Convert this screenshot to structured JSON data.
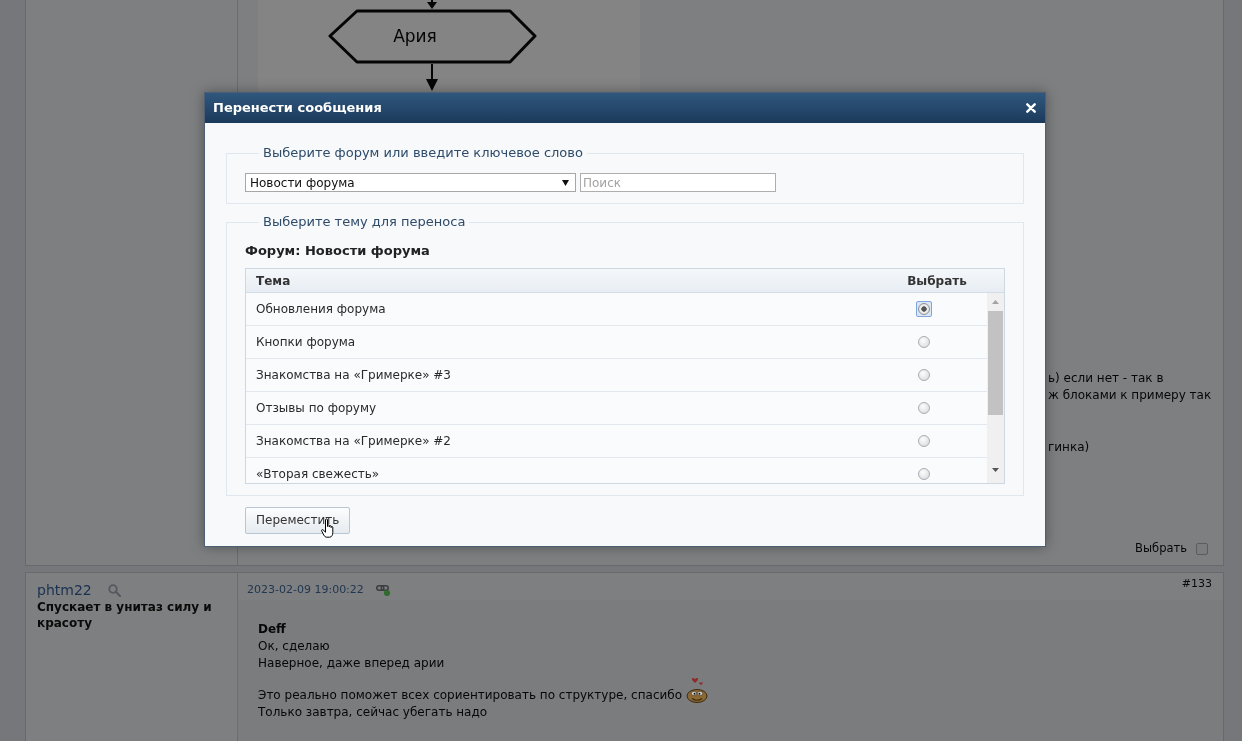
{
  "upper_post": {
    "diagram": {
      "node_label": "Ария"
    },
    "paragraphs": [
      [
        "ь) если нет - так в",
        "ж блоками к примеру так"
      ],
      [
        "гинка)"
      ]
    ],
    "select": {
      "label": "Выбрать",
      "checked": false
    }
  },
  "dialog": {
    "title": "Перенести сообщения",
    "forum_group": {
      "legend": "Выберите форум или введите ключевое слово",
      "forum_select": {
        "value": "Новости форума"
      },
      "search": {
        "placeholder": "Поиск"
      }
    },
    "topic_group": {
      "legend": "Выберите тему для переноса",
      "forum_heading": "Форум: Новости форума",
      "table": {
        "columns": [
          "Тема",
          "Выбрать"
        ],
        "rows": [
          {
            "topic": "Обновления форума",
            "selected": true
          },
          {
            "topic": "Кнопки форума",
            "selected": false
          },
          {
            "topic": "Знакомства на «Гримерке» #3",
            "selected": false
          },
          {
            "topic": "Отзывы по форуму",
            "selected": false
          },
          {
            "topic": "Знакомства на «Гримерке» #2",
            "selected": false
          },
          {
            "topic": "«Вторая свежесть»",
            "selected": false
          }
        ]
      }
    },
    "move_button": "Переместить"
  },
  "lower_post": {
    "author": "phtm22",
    "status": "Спускает в унитаз силу и красоту",
    "date": "2023-02-09 19:00:22",
    "number": "#133",
    "addressee": "Deff",
    "paragraphs": [
      [
        {
          "text": "Ок, сделаю",
          "smiley": false
        },
        {
          "text": "Наверное, даже вперед арии",
          "smiley": false
        }
      ],
      [
        {
          "text": "Это реально поможет всех сориентировать по структуре, спасибо",
          "smiley": true
        },
        {
          "text": "Только завтра, сейчас убегать надо",
          "smiley": false
        }
      ]
    ]
  }
}
